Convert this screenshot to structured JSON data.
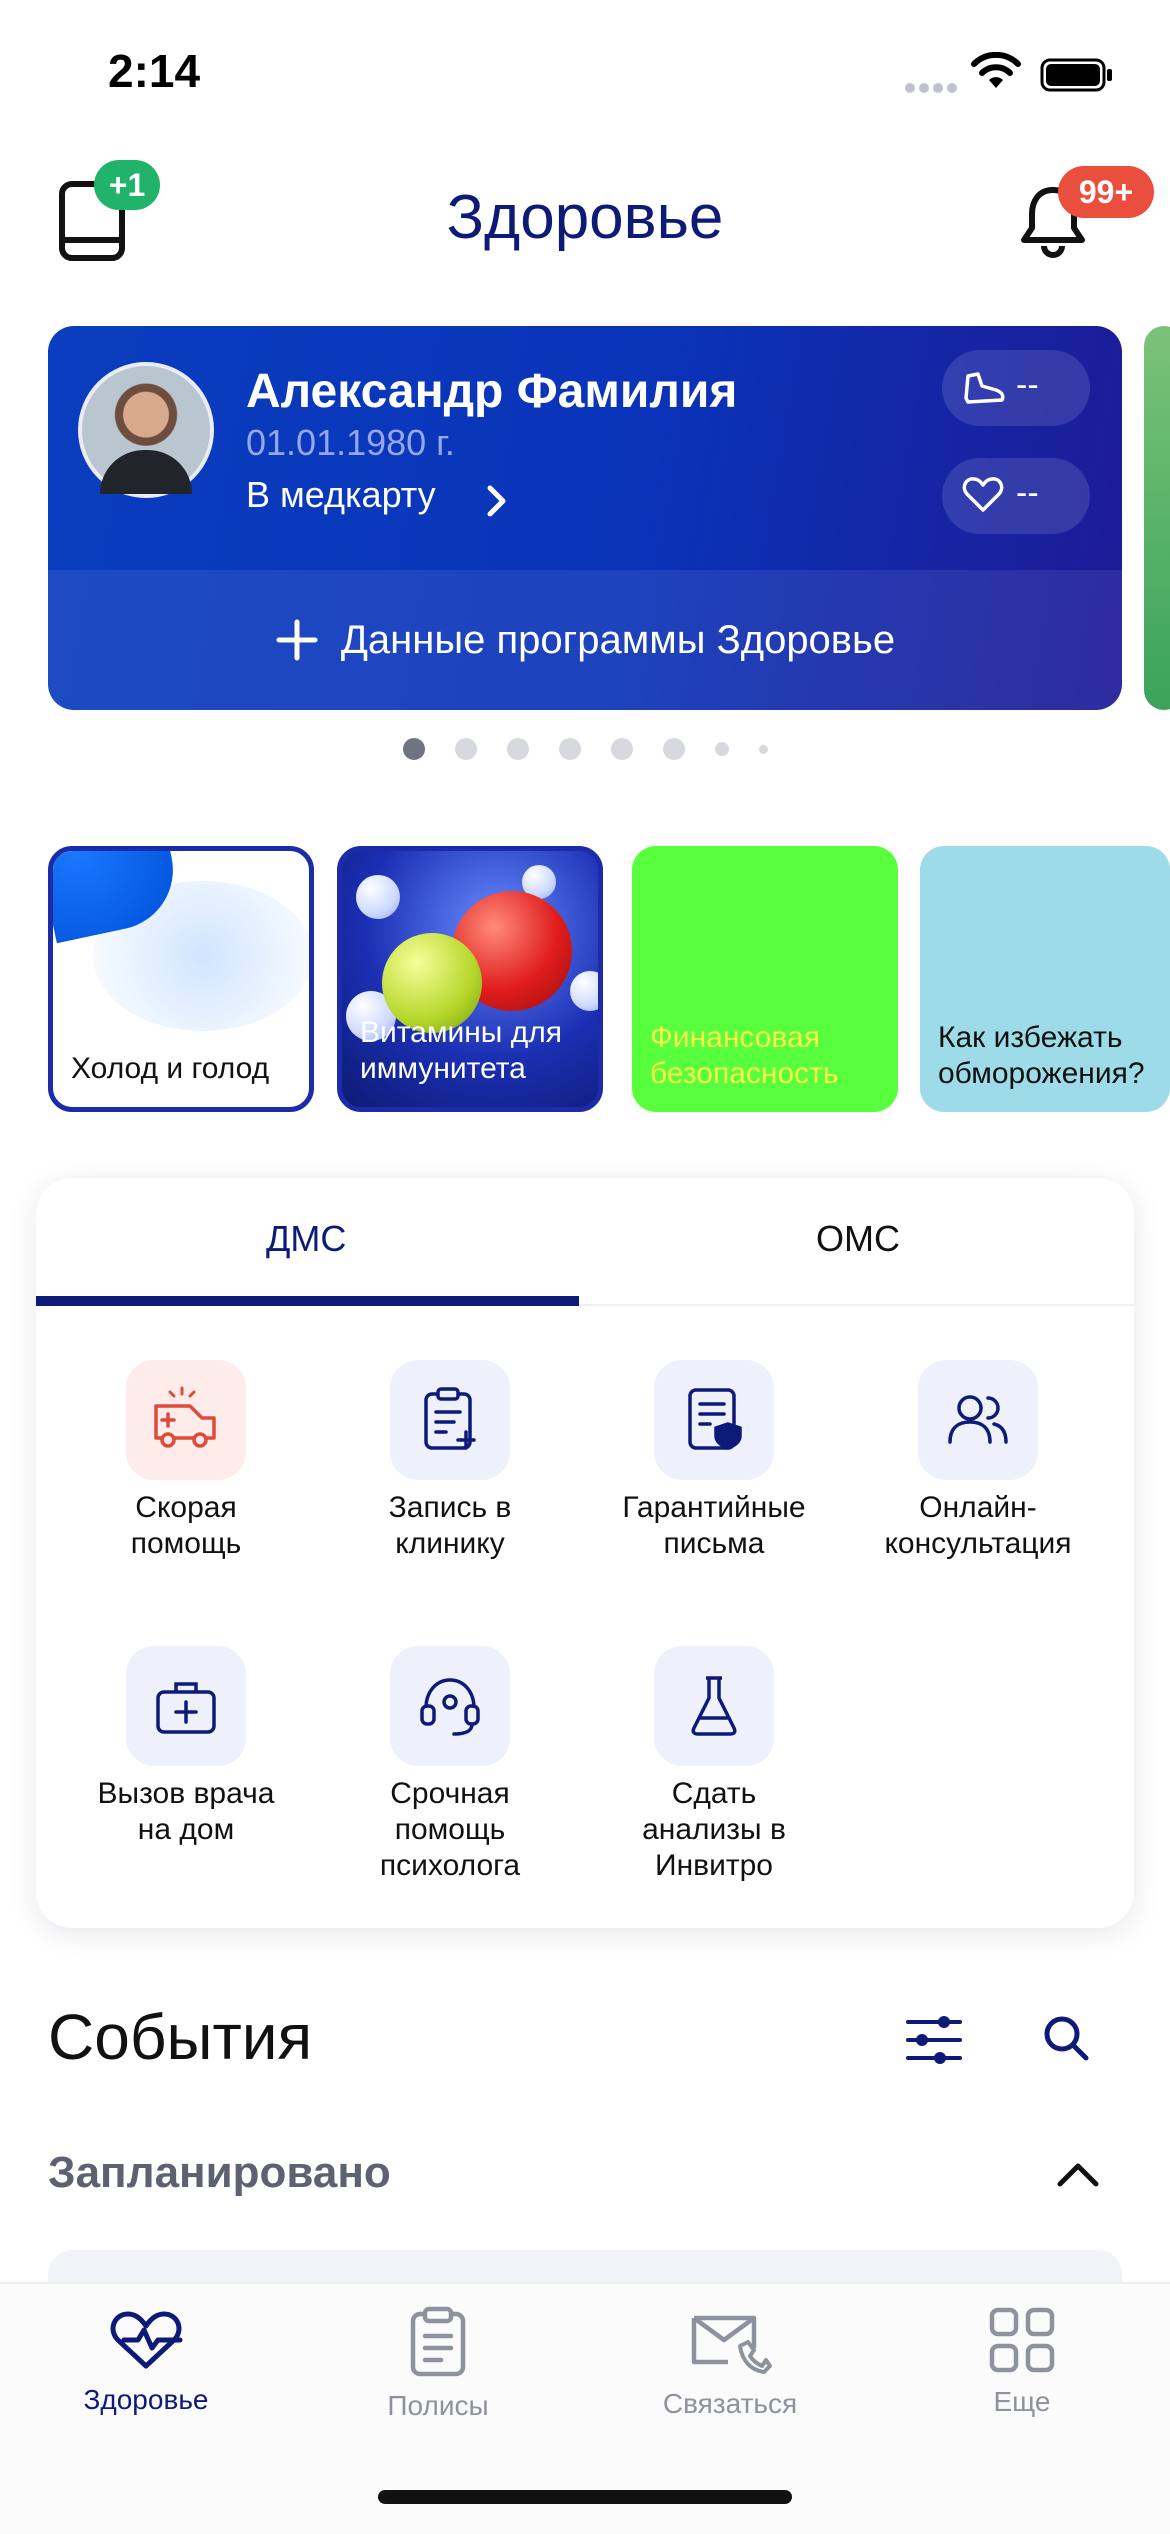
{
  "status_bar": {
    "time": "2:14"
  },
  "header": {
    "title": "Здоровье",
    "book_badge": "+1",
    "notifications_badge": "99+"
  },
  "profile": {
    "name": "Александр Фамилия",
    "birth_date": "01.01.1980 г.",
    "medcard_link": "В медкарту",
    "steps_value": "--",
    "heart_value": "--",
    "program_button": "Данные программы Здоровье"
  },
  "carousel": {
    "page_count": 8,
    "active_index": 0
  },
  "stories": [
    {
      "title": "Холод и голод"
    },
    {
      "title": "Витамины для иммунитета"
    },
    {
      "title": "Финансовая безопасность"
    },
    {
      "title": "Как избежать обморожения?"
    }
  ],
  "services": {
    "tabs": [
      "ДМС",
      "ОМС"
    ],
    "active_tab": "ДМС",
    "items": [
      {
        "label": "Скорая помощь",
        "icon": "ambulance-icon"
      },
      {
        "label": "Запись в клинику",
        "icon": "clipboard-plus-icon"
      },
      {
        "label": "Гарантийные письма",
        "icon": "document-shield-icon"
      },
      {
        "label": "Онлайн-консультация",
        "icon": "people-icon"
      },
      {
        "label": "Вызов врача на дом",
        "icon": "medical-bag-icon"
      },
      {
        "label": "Срочная помощь психолога",
        "icon": "headset-icon"
      },
      {
        "label": "Сдать анализы в Инвитро",
        "icon": "flask-icon"
      }
    ]
  },
  "events": {
    "title": "События",
    "planned_section": "Запланировано"
  },
  "bottom_nav": {
    "items": [
      {
        "label": "Здоровье",
        "icon": "heart-pulse-icon",
        "active": true
      },
      {
        "label": "Полисы",
        "icon": "clipboard-icon",
        "active": false
      },
      {
        "label": "Связаться",
        "icon": "envelope-phone-icon",
        "active": false
      },
      {
        "label": "Еще",
        "icon": "grid-icon",
        "active": false
      }
    ]
  },
  "colors": {
    "brand_navy": "#0e1a78",
    "card_blue": "#0a3dbf",
    "badge_green": "#21b36a",
    "badge_red": "#ea4f3d",
    "story_green": "#58ff3c",
    "story_cyan": "#9ddbe8"
  }
}
